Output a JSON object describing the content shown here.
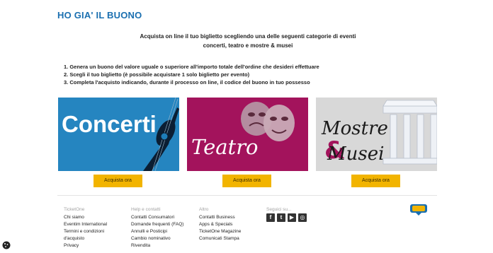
{
  "page": {
    "title": "HO GIA' IL BUONO",
    "intro_line1": "Acquista on line il tuo biglietto scegliendo una delle seguenti categorie di eventi",
    "intro_line2": "concerti, teatro e mostre & musei",
    "steps": [
      "1. Genera un buono del valore uguale o superiore all'importo totale dell'ordine che desideri effettuare",
      "2. Scegli il tuo biglietto (è possibile acquistare 1 solo biglietto per evento)",
      "3. Completa l'acquisto indicando, durante il processo on line, il codice del buono in tuo possesso"
    ]
  },
  "categories": [
    {
      "label": "Concerti",
      "button": "Acquista ora",
      "bg": "#1e7db8",
      "icon": "guitar-icon"
    },
    {
      "label": "Teatro",
      "button": "Acquista ora",
      "bg": "#a3135c",
      "icon": "theater-masks-icon"
    },
    {
      "label_line1": "Mostre",
      "amp": "&",
      "label_line2": "Musei",
      "button": "Acquista ora",
      "bg": "#d8d8d8",
      "icon": "museum-columns-icon"
    }
  ],
  "footer": {
    "col1": {
      "head": "TicketOne",
      "links": [
        "Chi siamo",
        "Eventim International",
        "Termini e condizioni",
        "d'acquisto",
        "Privacy"
      ]
    },
    "col2": {
      "head": "Help e contatti",
      "links": [
        "Contatti Consumatori",
        "Domande frequenti (FAQ)",
        "Annulli e Posticipi",
        "Cambio nominativo",
        "Rivendita"
      ]
    },
    "col3": {
      "head": "Altro",
      "links": [
        "Contatti Business",
        "Apps & Specials",
        "TicketOne Magazine",
        "Comunicati Stampa"
      ]
    },
    "col4": {
      "head": "Seguici su...",
      "social": [
        "facebook-icon",
        "twitter-icon",
        "youtube-icon",
        "instagram-icon"
      ]
    }
  },
  "colors": {
    "accent": "#1a6fb0",
    "button": "#f2b400"
  }
}
